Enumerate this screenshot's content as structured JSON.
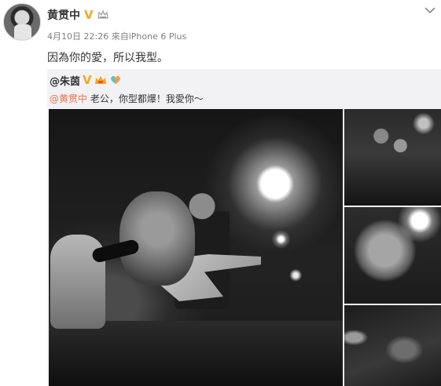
{
  "author": {
    "name": "黄贯中",
    "verified_mark": "V",
    "badge_icon": "crown-icon"
  },
  "meta": {
    "date": "4月10日 22:26",
    "source_prefix": "來自",
    "device": "iPhone 6 Plus"
  },
  "post": {
    "text": "因為你的愛，所以我型。"
  },
  "repost": {
    "author": "@朱茵",
    "verified_mark": "V",
    "badges": [
      "vip-crown-icon",
      "heart-balloon-icon"
    ],
    "mention": "@黄贯中",
    "body": " 老公，你型都爆！我愛你～"
  },
  "images": [
    {
      "name": "concert-photo-main",
      "description_icon": "photo-icon"
    },
    {
      "name": "concert-photo-2",
      "description_icon": "photo-icon"
    },
    {
      "name": "concert-photo-3",
      "description_icon": "photo-icon"
    },
    {
      "name": "concert-photo-4",
      "description_icon": "photo-icon"
    }
  ],
  "colors": {
    "accent_mention": "#eb7350",
    "verified": "#f5a623",
    "repost_bg": "#f2f2f5",
    "meta_text": "#808080"
  }
}
